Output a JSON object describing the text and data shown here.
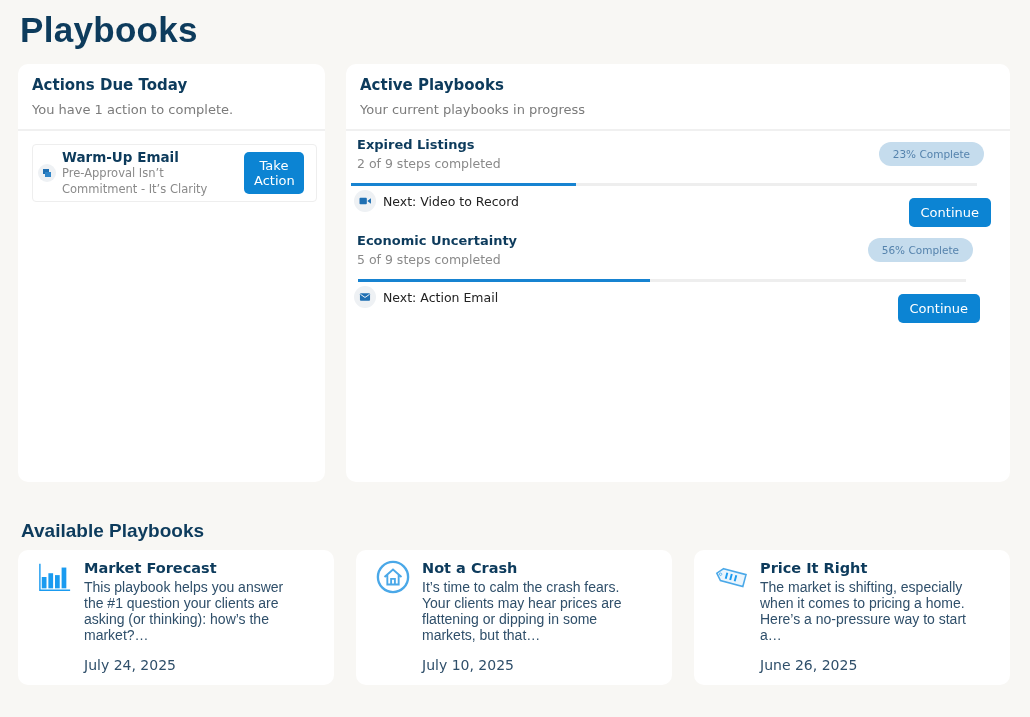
{
  "page_title": "Playbooks",
  "actions_due": {
    "title": "Actions Due Today",
    "subtitle": "You have 1 action to complete.",
    "items": [
      {
        "title": "Warm-Up Email",
        "subtitle": "Pre-Approval Isn’t Commitment - It’s Clarity",
        "button": "Take Action"
      }
    ]
  },
  "active_playbooks": {
    "title": "Active Playbooks",
    "subtitle": "Your current playbooks in progress",
    "items": [
      {
        "title": "Expired Listings",
        "steps": "2 of 9 steps completed",
        "badge": "23% Complete",
        "level": 0.36,
        "kind": "video",
        "next": "Next: Video to Record",
        "button": "Continue"
      },
      {
        "title": "Economic Uncertainty",
        "steps": "5 of 9 steps completed",
        "badge": "56% Complete",
        "level": 0.48,
        "kind": "email",
        "next": "Next: Action Email",
        "button": "Continue"
      }
    ]
  },
  "available_playbooks": {
    "title": "Available Playbooks",
    "items": [
      {
        "kind": "chart",
        "title": "Market Forecast",
        "description": "This playbook helps you answer the #1 question your clients are asking (or thinking): how’s the market?…",
        "date": "July 24, 2025"
      },
      {
        "kind": "house",
        "title": "Not a Crash",
        "description": "It’s time to calm the crash fears. Your clients may hear prices are flattening or dipping in some markets, but that…",
        "date": "July 10, 2025"
      },
      {
        "kind": "tag",
        "title": "Price It Right",
        "description": "The market is shifting, especially when it comes to pricing a home. Here’s a no-pressure way to start a…",
        "date": "June 26, 2025"
      }
    ]
  }
}
